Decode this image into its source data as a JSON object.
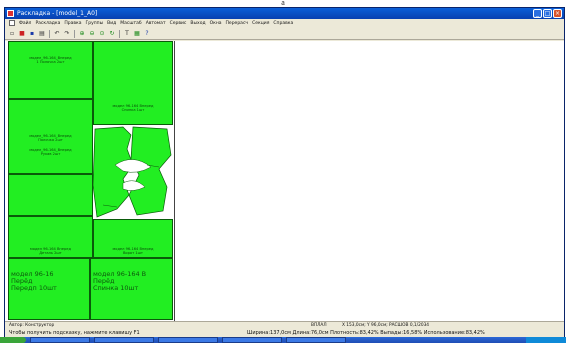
{
  "figure_caption": "a",
  "window": {
    "title": "Раскладка - [model_1_A0]",
    "buttons": [
      "_",
      "□",
      "×"
    ]
  },
  "menu": [
    "Файл",
    "Раскладка",
    "Правка",
    "Группы",
    "Вид",
    "Масштаб",
    "Автомат",
    "Сервис",
    "Выход",
    "Окна",
    "Перерасч",
    "Секция",
    "Справка"
  ],
  "toolbar": {
    "icons": [
      {
        "name": "new-icon",
        "glyph": "▫"
      },
      {
        "name": "open-icon",
        "glyph": "■"
      },
      {
        "name": "save-icon",
        "glyph": "▪"
      },
      {
        "name": "print-icon",
        "glyph": "▤"
      },
      {
        "name": "undo-icon",
        "glyph": "↶"
      },
      {
        "name": "redo-icon",
        "glyph": "↷"
      },
      {
        "name": "zoom-in-icon",
        "glyph": "⊕"
      },
      {
        "name": "zoom-out-icon",
        "glyph": "⊖"
      },
      {
        "name": "zoom-all-icon",
        "glyph": "⊙"
      },
      {
        "name": "rotate-icon",
        "glyph": "↻"
      },
      {
        "name": "text-icon",
        "glyph": "T"
      },
      {
        "name": "grid-icon",
        "glyph": "▦"
      },
      {
        "name": "help-icon",
        "glyph": "?"
      }
    ]
  },
  "pieces": {
    "p1": "модел_96-164_Вперед\n1 Полочка 2шт",
    "p2": "модел 96-164 Вперед\nСпинка 1шт",
    "p3": "модел_96-164_Вперед\nПолочка 2шт",
    "p4": "модел_96-164_Вперед\nРукав 2шт",
    "p5": "модел 96-164 Вперед\nДеталь 2шт",
    "p6": "модел 96-164 Вперед\nВорот 1шт",
    "p7": "модел 96-16\nПерёд\nПередп 10шт",
    "p8": "модел 96-164 В\nПерёд\nСпинка 10шт"
  },
  "status": {
    "author": "Автор: Конструктор",
    "field": "ВПЛАЛ",
    "coords": "Х 153,0см; Y 96,0см; РАСШОВ 0,1/2034",
    "hint": "Чтобы получить подсказку, нажмите клавишу F1",
    "stats": "Ширина:137,0см Длина:76,0см Плотность:83,42% Выпады:16,58% Использование:83,42%"
  },
  "colors": {
    "piece_fill": "#22ee22",
    "piece_border": "#0a5a0a",
    "titlebar": "#0a5fd8"
  }
}
